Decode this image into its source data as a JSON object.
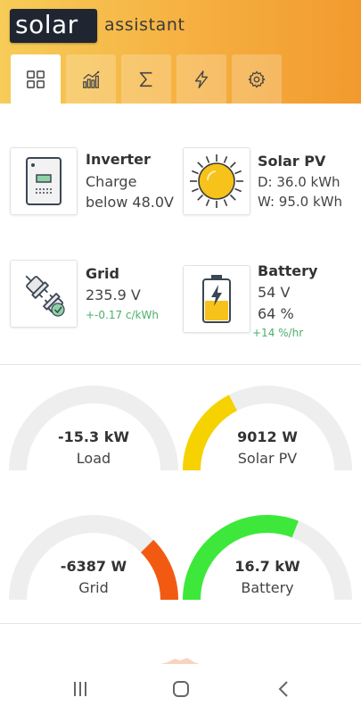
{
  "header": {
    "logo_main": "solar",
    "logo_sub": "assistant",
    "tabs": [
      {
        "icon": "dashboard-grid-icon",
        "active": true
      },
      {
        "icon": "chart-icon",
        "active": false
      },
      {
        "icon": "sigma-icon",
        "active": false
      },
      {
        "icon": "lightning-icon",
        "active": false
      },
      {
        "icon": "gear-icon",
        "active": false
      }
    ]
  },
  "summary": {
    "inverter": {
      "title": "Inverter",
      "line1": "Charge",
      "line2": "below 48.0V"
    },
    "solar": {
      "title": "Solar PV",
      "line1": "D: 36.0 kWh",
      "line2": "W: 95.0 kWh"
    },
    "grid": {
      "title": "Grid",
      "line1": "235.9 V",
      "line2": "+-0.17 c/kWh"
    },
    "battery": {
      "title": "Battery",
      "line1": "54 V",
      "line2": "64 %",
      "line3": "+14 %/hr"
    }
  },
  "gauges": [
    {
      "value": "-15.3 kW",
      "label": "Load",
      "fill_fraction": 0,
      "color": "#e0e0e0"
    },
    {
      "value": "9012 W",
      "label": "Solar PV",
      "fill_fraction": 0.35,
      "color": "#f5d200"
    },
    {
      "value": "-6387 W",
      "label": "Grid",
      "fill_fraction": 0.25,
      "color": "#f25a12"
    },
    {
      "value": "16.7 kW",
      "label": "Battery",
      "fill_fraction": 0.62,
      "color": "#3ee83a"
    }
  ],
  "colors": {
    "header_start": "#f7cc58",
    "header_end": "#f29a2e",
    "positive_green": "#4caf6a",
    "gauge_track": "#eeeeee"
  },
  "navbar": {
    "icons": [
      "recent-apps-icon",
      "home-icon",
      "back-icon"
    ]
  }
}
